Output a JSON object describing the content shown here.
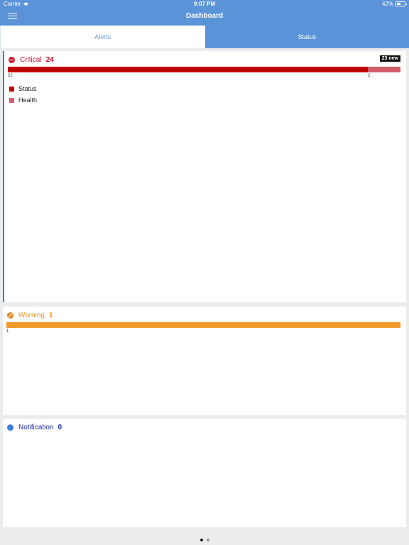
{
  "status_bar": {
    "carrier": "Carrier",
    "time": "9:07 PM",
    "battery": "42%"
  },
  "nav": {
    "title": "Dashboard",
    "menu_icon": "menu-icon"
  },
  "tabs": [
    {
      "label": "Alerts",
      "active": false
    },
    {
      "label": "Status",
      "active": true
    }
  ],
  "panels": {
    "critical": {
      "label": "Critical",
      "count": "24",
      "badge": "23 new",
      "color": "#c8102e",
      "bar": [
        {
          "name": "Status",
          "value": 22,
          "label": "22",
          "color": "#c00000"
        },
        {
          "name": "Health",
          "value": 2,
          "label": "2",
          "color": "#d35d6a"
        }
      ],
      "legend": [
        {
          "label": "Status",
          "color": "#c00000"
        },
        {
          "label": "Health",
          "color": "#d35d6a"
        }
      ]
    },
    "warning": {
      "label": "Warning",
      "count": "1",
      "color": "#e8901f",
      "bar": [
        {
          "value": 1,
          "label": "1",
          "color": "#ef9a2a"
        }
      ]
    },
    "notification": {
      "label": "Notification",
      "count": "0",
      "color": "#1c2a9c"
    }
  },
  "pager": {
    "pages": 2,
    "current": 0
  }
}
